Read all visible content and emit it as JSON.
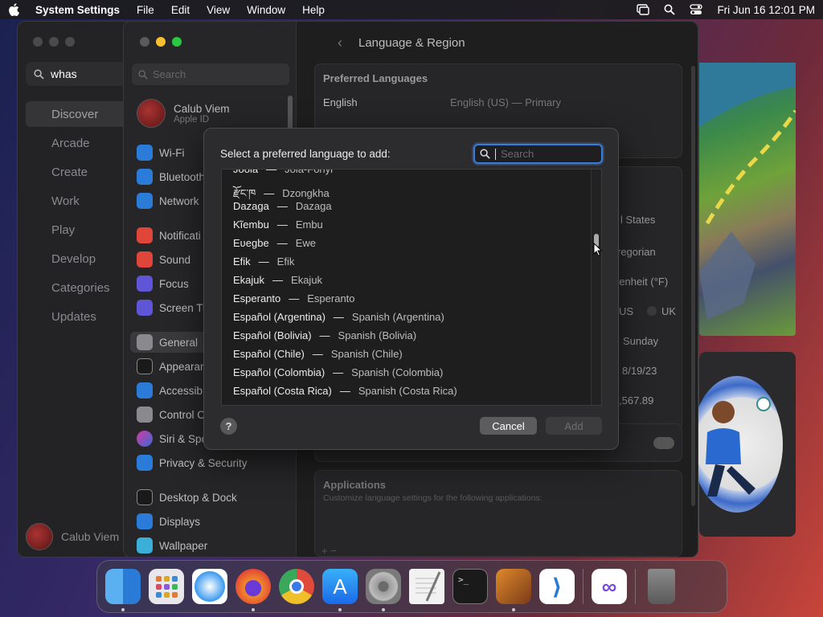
{
  "menubar": {
    "app_name": "System Settings",
    "items": [
      "File",
      "Edit",
      "View",
      "Window",
      "Help"
    ],
    "clock": "Fri Jun 16  12:01 PM"
  },
  "appstore": {
    "search_value": "whas",
    "nav": [
      "Discover",
      "Arcade",
      "Create",
      "Work",
      "Play",
      "Develop",
      "Categories",
      "Updates"
    ],
    "user_name": "Calub Viem"
  },
  "settings": {
    "search_placeholder": "Search",
    "account_name": "Calub Viem",
    "account_sub": "Apple ID",
    "sidebar": {
      "wifi": "Wi-Fi",
      "bluetooth": "Bluetooth",
      "network": "Network",
      "notifications": "Notificati",
      "sound": "Sound",
      "focus": "Focus",
      "screen_time": "Screen Ti",
      "general": "General",
      "appearance": "Appearan",
      "accessibility": "Accessib",
      "control_center": "Control C",
      "siri": "Siri & Spo",
      "privacy": "Privacy & Security",
      "desktop_dock": "Desktop & Dock",
      "displays": "Displays",
      "wallpaper": "Wallpaper"
    },
    "page_title": "Language & Region",
    "preferred_languages_heading": "Preferred Languages",
    "pref_lang_name": "English",
    "pref_lang_detail": "English (US) — Primary",
    "region_value": "l States",
    "calendar_value": "regorian",
    "temperature_value": "renheit (°F)",
    "measurement_us": "US",
    "measurement_uk": "UK",
    "first_day_value": "Sunday",
    "date_format_value": "8/19/23",
    "number_format_value": ",567.89",
    "applications_heading": "Applications",
    "applications_desc": "Customize language settings for the following applications:",
    "add_remove": "+  −"
  },
  "dialog": {
    "prompt": "Select a preferred language to add:",
    "search_placeholder": "Search",
    "languages": [
      {
        "native": "Joola",
        "english": "Jola-Fonyi"
      },
      {
        "native": "རྫོང་ཁ",
        "english": "Dzongkha"
      },
      {
        "native": "Dazaga",
        "english": "Dazaga"
      },
      {
        "native": "Kĩembu",
        "english": "Embu"
      },
      {
        "native": "Eʋegbe",
        "english": "Ewe"
      },
      {
        "native": "Efik",
        "english": "Efik"
      },
      {
        "native": "Ekajuk",
        "english": "Ekajuk"
      },
      {
        "native": "Esperanto",
        "english": "Esperanto"
      },
      {
        "native": "Español (Argentina)",
        "english": "Spanish (Argentina)"
      },
      {
        "native": "Español (Bolivia)",
        "english": "Spanish (Bolivia)"
      },
      {
        "native": "Español (Chile)",
        "english": "Spanish (Chile)"
      },
      {
        "native": "Español (Colombia)",
        "english": "Spanish (Colombia)"
      },
      {
        "native": "Español (Costa Rica)",
        "english": "Spanish (Costa Rica)"
      }
    ],
    "separator": "—",
    "help": "?",
    "cancel": "Cancel",
    "add": "Add"
  },
  "dock": {
    "apps": [
      "Finder",
      "Launchpad",
      "Safari",
      "Firefox",
      "Chrome",
      "App Store",
      "System Settings",
      "TextEdit",
      "Terminal",
      "GarageBand",
      "VS Code",
      "Visual Studio",
      "Trash"
    ]
  }
}
